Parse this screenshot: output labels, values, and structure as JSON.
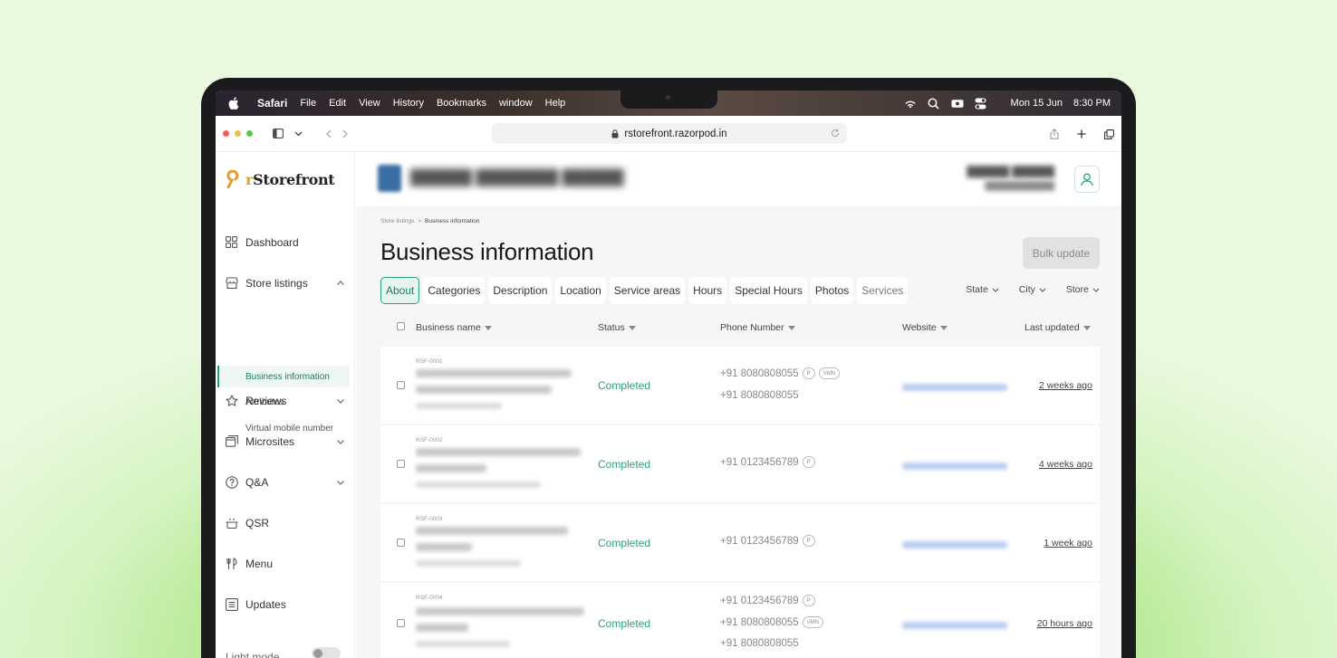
{
  "menubar": {
    "app": "Safari",
    "items": [
      "File",
      "Edit",
      "View",
      "History",
      "Bookmarks",
      "window",
      "Help"
    ],
    "date": "Mon 15 Jun",
    "time": "8:30 PM"
  },
  "browser": {
    "url": "rstorefront.razorpod.in"
  },
  "sidebar": {
    "logo_r": "r",
    "logo_text": "Storefront",
    "items": [
      {
        "label": "Dashboard"
      },
      {
        "label": "Store listings"
      },
      {
        "label": "Reviews"
      },
      {
        "label": "Microsites"
      },
      {
        "label": "Q&A"
      },
      {
        "label": "QSR"
      },
      {
        "label": "Menu"
      },
      {
        "label": "Updates"
      }
    ],
    "sub_items": [
      "Business information",
      "Attributes",
      "Virtual mobile number"
    ],
    "light_mode": "Light mode"
  },
  "breadcrumb": {
    "parent": "Store listings",
    "separator": ">",
    "current": "Business information"
  },
  "page": {
    "title": "Business information",
    "bulk_update": "Bulk update"
  },
  "tabs": [
    "About",
    "Categories",
    "Description",
    "Location",
    "Service areas",
    "Hours",
    "Special Hours",
    "Photos",
    "Services"
  ],
  "filters": [
    "State",
    "City",
    "Store"
  ],
  "table": {
    "headers": [
      "Business name",
      "Status",
      "Phone Number",
      "Website",
      "Last updated"
    ],
    "rows": [
      {
        "id": "RSF-0001",
        "status": "Completed",
        "phones": [
          {
            "number": "+91 8080808055",
            "tags": [
              "P",
              "VMN"
            ]
          },
          {
            "number": "+91 8080808055",
            "tags": []
          }
        ],
        "updated": "2 weeks ago"
      },
      {
        "id": "RSF-0002",
        "status": "Completed",
        "phones": [
          {
            "number": "+91 0123456789",
            "tags": [
              "P"
            ]
          }
        ],
        "updated": "4 weeks ago"
      },
      {
        "id": "RSF-0003",
        "status": "Completed",
        "phones": [
          {
            "number": "+91 0123456789",
            "tags": [
              "P"
            ]
          }
        ],
        "updated": "1 week ago"
      },
      {
        "id": "RSF-0004",
        "status": "Completed",
        "phones": [
          {
            "number": "+91 0123456789",
            "tags": [
              "P"
            ]
          },
          {
            "number": "+91 8080808055",
            "tags": [
              "VMN"
            ]
          },
          {
            "number": "+91 8080808055",
            "tags": []
          }
        ],
        "updated": "20 hours ago"
      }
    ]
  },
  "colors": {
    "accent": "#2a9d7e",
    "status_completed": "#2ea073",
    "logo_accent": "#e39c2d"
  }
}
